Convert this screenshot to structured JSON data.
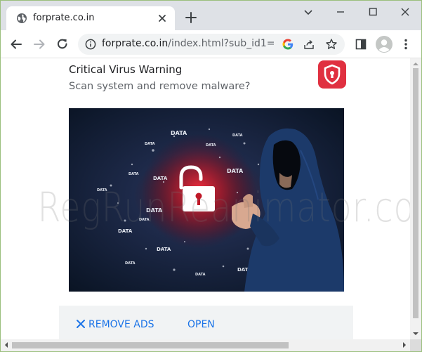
{
  "browser": {
    "tab_title": "forprate.co.in",
    "url_host": "forprate.co.in",
    "url_path": "/index.html?sub_id1=",
    "icons": {
      "favicon": "globe-icon",
      "tab_close": "close-icon",
      "new_tab": "plus-icon",
      "minimize": "minimize-icon",
      "maximize": "maximize-icon",
      "window_close": "close-icon",
      "chevron": "chevron-down-icon",
      "back": "back-arrow-icon",
      "forward": "forward-arrow-icon",
      "reload": "reload-icon",
      "site_info": "info-icon",
      "google": "google-icon",
      "share": "share-icon",
      "bookmark": "star-icon",
      "side_panel": "side-panel-icon",
      "profile": "profile-avatar-icon",
      "menu": "kebab-menu-icon"
    }
  },
  "notification": {
    "title": "Critical Virus Warning",
    "subtitle": "Scan system and remove malware?",
    "badge_icon": "shield-icon",
    "image_icon": "hacker-unlocked-padlock-image",
    "data_label": "DATA",
    "remove_ads_label": "REMOVE ADS",
    "open_label": "OPEN"
  },
  "watermark": "RegRunReanimator.com",
  "colors": {
    "accent": "#1a73e8",
    "badge": "#e03040",
    "tabstrip": "#dee1e6"
  }
}
